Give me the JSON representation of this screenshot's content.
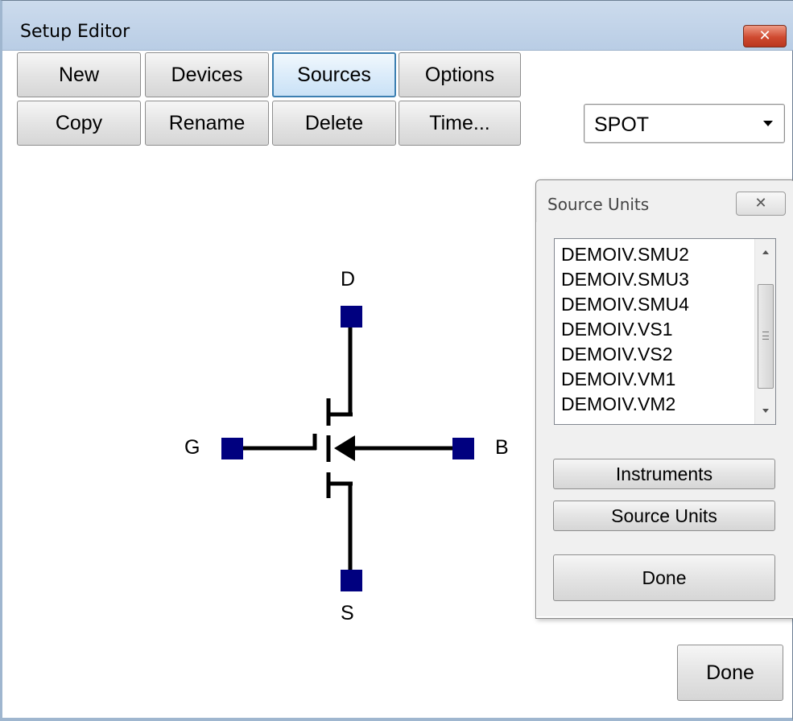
{
  "window": {
    "title": "Setup Editor",
    "close_glyph": "✕"
  },
  "toolbar": {
    "row1": [
      "New",
      "Devices",
      "Sources",
      "Options"
    ],
    "row2": [
      "Copy",
      "Rename",
      "Delete",
      "Time..."
    ]
  },
  "mode_select": {
    "value": "SPOT",
    "arrow_icon": "chevron-down-icon"
  },
  "device": {
    "terminals": {
      "drain": "D",
      "gate": "G",
      "bulk": "B",
      "source": "S"
    },
    "terminal_color": "#00007f"
  },
  "source_units_dialog": {
    "title": "Source Units",
    "close_glyph": "✕",
    "units": [
      "DEMOIV.SMU2",
      "DEMOIV.SMU3",
      "DEMOIV.SMU4",
      "DEMOIV.VS1",
      "DEMOIV.VS2",
      "DEMOIV.VM1",
      "DEMOIV.VM2"
    ],
    "instruments_button": "Instruments",
    "source_units_button": "Source Units",
    "done_button": "Done"
  },
  "footer": {
    "done_button": "Done"
  }
}
